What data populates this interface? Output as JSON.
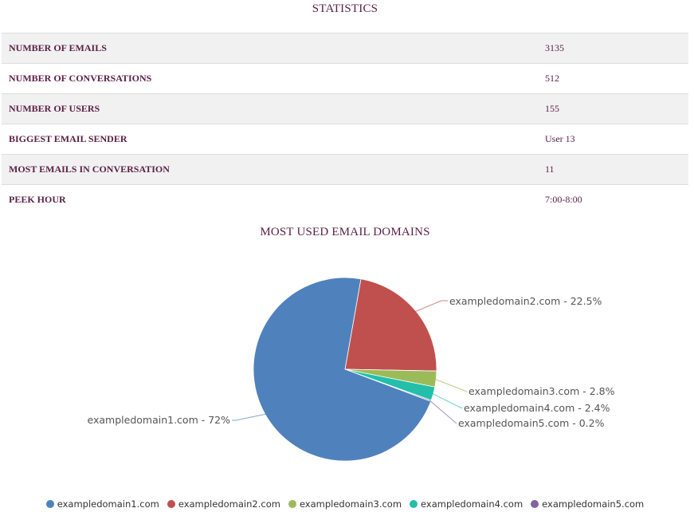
{
  "statistics": {
    "title": "STATISTICS",
    "rows": [
      {
        "label": "NUMBER OF EMAILS",
        "value": "3135"
      },
      {
        "label": "NUMBER OF CONVERSATIONS",
        "value": "512"
      },
      {
        "label": "NUMBER OF USERS",
        "value": "155"
      },
      {
        "label": "BIGGEST EMAIL SENDER",
        "value": "User 13"
      },
      {
        "label": "MOST EMAILS IN CONVERSATION",
        "value": "11"
      },
      {
        "label": "PEEK HOUR",
        "value": "7:00-8:00"
      }
    ]
  },
  "chart_data": {
    "type": "pie",
    "title": "MOST USED EMAIL DOMAINS",
    "start_angle_deg": 10,
    "legend_position": "bottom-center",
    "slices": [
      {
        "name": "exampledomain2.com",
        "value": 22.5,
        "label": "exampledomain2.com - 22.5%",
        "color": "#c0504d"
      },
      {
        "name": "exampledomain3.com",
        "value": 2.8,
        "label": "exampledomain3.com - 2.8%",
        "color": "#9bbb59"
      },
      {
        "name": "exampledomain4.com",
        "value": 2.4,
        "label": "exampledomain4.com - 2.4%",
        "color": "#23bfaa"
      },
      {
        "name": "exampledomain5.com",
        "value": 0.2,
        "label": "exampledomain5.com - 0.2%",
        "color": "#8064a2"
      },
      {
        "name": "exampledomain1.com",
        "value": 72,
        "label": "exampledomain1.com - 72%",
        "color": "#4f81bd"
      }
    ],
    "legend": [
      {
        "name": "exampledomain1.com",
        "color": "#4f81bd"
      },
      {
        "name": "exampledomain2.com",
        "color": "#c0504d"
      },
      {
        "name": "exampledomain3.com",
        "color": "#9bbb59"
      },
      {
        "name": "exampledomain4.com",
        "color": "#23bfaa"
      },
      {
        "name": "exampledomain5.com",
        "color": "#8064a2"
      }
    ]
  }
}
